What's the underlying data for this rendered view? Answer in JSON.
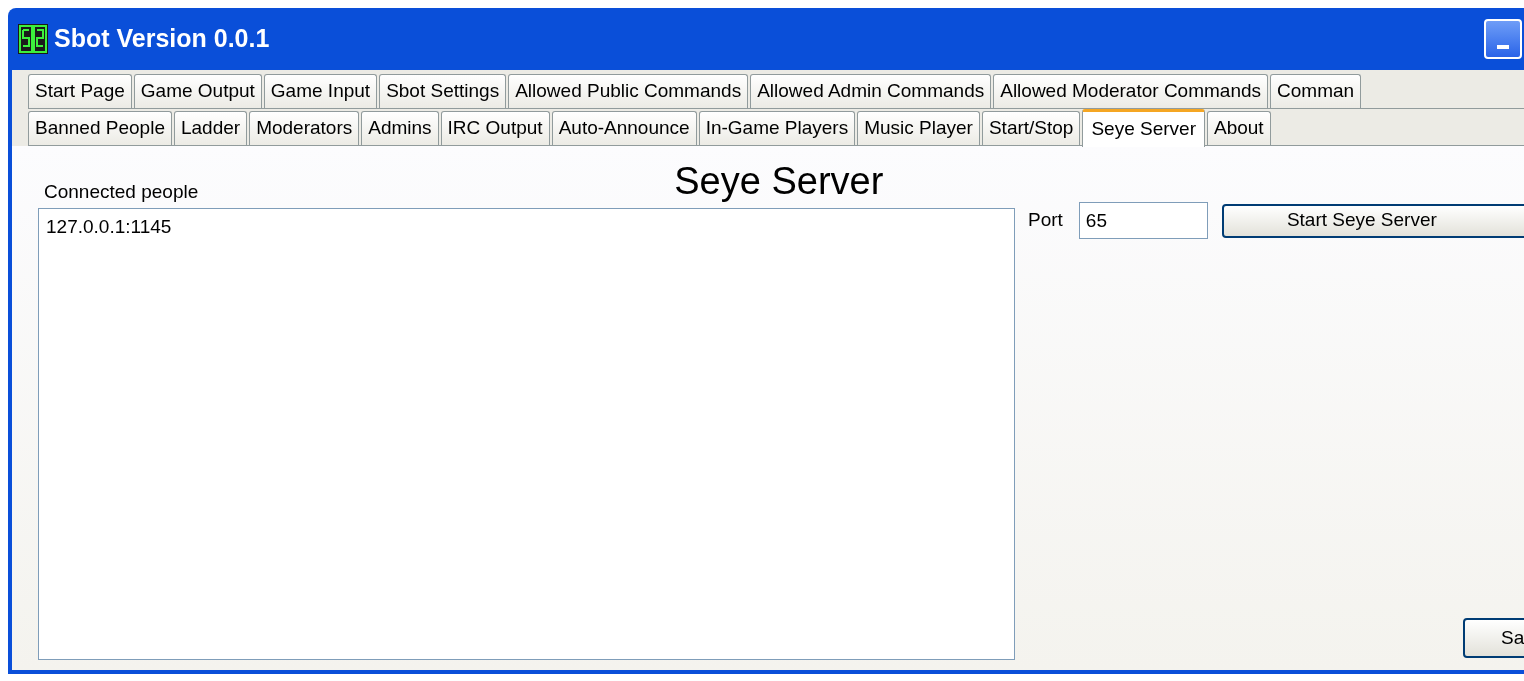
{
  "window": {
    "title": "Sbot Version 0.0.1"
  },
  "tab_rows": [
    [
      {
        "label": "Start Page",
        "selected": false
      },
      {
        "label": "Game Output",
        "selected": false
      },
      {
        "label": "Game Input",
        "selected": false
      },
      {
        "label": "Sbot Settings",
        "selected": false
      },
      {
        "label": "Allowed Public Commands",
        "selected": false
      },
      {
        "label": "Allowed Admin Commands",
        "selected": false
      },
      {
        "label": "Allowed Moderator Commands",
        "selected": false
      },
      {
        "label": "Comman",
        "selected": false
      }
    ],
    [
      {
        "label": "Banned People",
        "selected": false
      },
      {
        "label": "Ladder",
        "selected": false
      },
      {
        "label": "Moderators",
        "selected": false
      },
      {
        "label": "Admins",
        "selected": false
      },
      {
        "label": "IRC Output",
        "selected": false
      },
      {
        "label": "Auto-Announce",
        "selected": false
      },
      {
        "label": "In-Game Players",
        "selected": false
      },
      {
        "label": "Music Player",
        "selected": false
      },
      {
        "label": "Start/Stop",
        "selected": false
      },
      {
        "label": "Seye Server",
        "selected": true
      },
      {
        "label": "About",
        "selected": false
      }
    ]
  ],
  "panel": {
    "title": "Seye Server",
    "list_label": "Connected people",
    "list_items": [
      "127.0.0.1:1145"
    ],
    "port_label": "Port",
    "port_value": "65",
    "start_button": "Start Seye Server",
    "bottom_button": "Sa"
  }
}
